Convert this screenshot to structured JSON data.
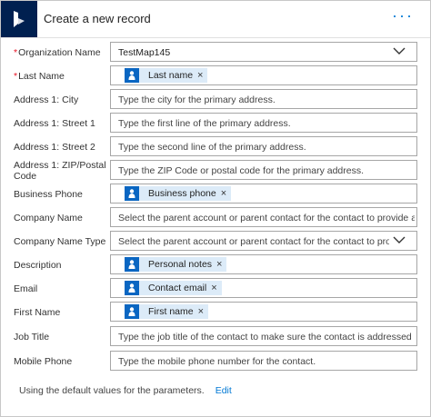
{
  "header": {
    "title": "Create a new record",
    "more_label": "···"
  },
  "fields": [
    {
      "label": "Organization Name",
      "required": true,
      "type": "dropdown",
      "value": "TestMap145"
    },
    {
      "label": "Last Name",
      "required": true,
      "type": "token",
      "token": "Last name"
    },
    {
      "label": "Address 1: City",
      "type": "text",
      "placeholder": "Type the city for the primary address."
    },
    {
      "label": "Address 1: Street 1",
      "type": "text",
      "placeholder": "Type the first line of the primary address."
    },
    {
      "label": "Address 1: Street 2",
      "type": "text",
      "placeholder": "Type the second line of the primary address."
    },
    {
      "label_line1": "Address 1: ZIP/Postal",
      "label_line2": "Code",
      "type": "text",
      "placeholder": "Type the ZIP Code or postal code for the primary address."
    },
    {
      "label": "Business Phone",
      "type": "token",
      "token": "Business phone"
    },
    {
      "label": "Company Name",
      "type": "text",
      "placeholder": "Select the parent account or parent contact for the contact to provide a quic..."
    },
    {
      "label": "Company Name Type",
      "type": "dropdown",
      "placeholder": "Select the parent account or parent contact for the contact to provide..."
    },
    {
      "label": "Description",
      "type": "token",
      "token": "Personal notes"
    },
    {
      "label": "Email",
      "type": "token",
      "token": "Contact email"
    },
    {
      "label": "First Name",
      "type": "token",
      "token": "First name"
    },
    {
      "label": "Job Title",
      "type": "text",
      "placeholder": "Type the job title of the contact to make sure the contact is addressed correc..."
    },
    {
      "label": "Mobile Phone",
      "type": "text",
      "placeholder": "Type the mobile phone number for the contact."
    }
  ],
  "footer": {
    "text": "Using the default values for the parameters.",
    "edit_label": "Edit"
  },
  "colors": {
    "brand": "#002050",
    "accent": "#0078d4",
    "token_bg": "#dcebf8",
    "token_icon": "#0a66c2",
    "required": "#e81123"
  },
  "icons": {
    "app": "dynamics-logo-icon",
    "token": "user-icon",
    "dropdown": "chevron-down-icon",
    "remove": "close-icon"
  }
}
